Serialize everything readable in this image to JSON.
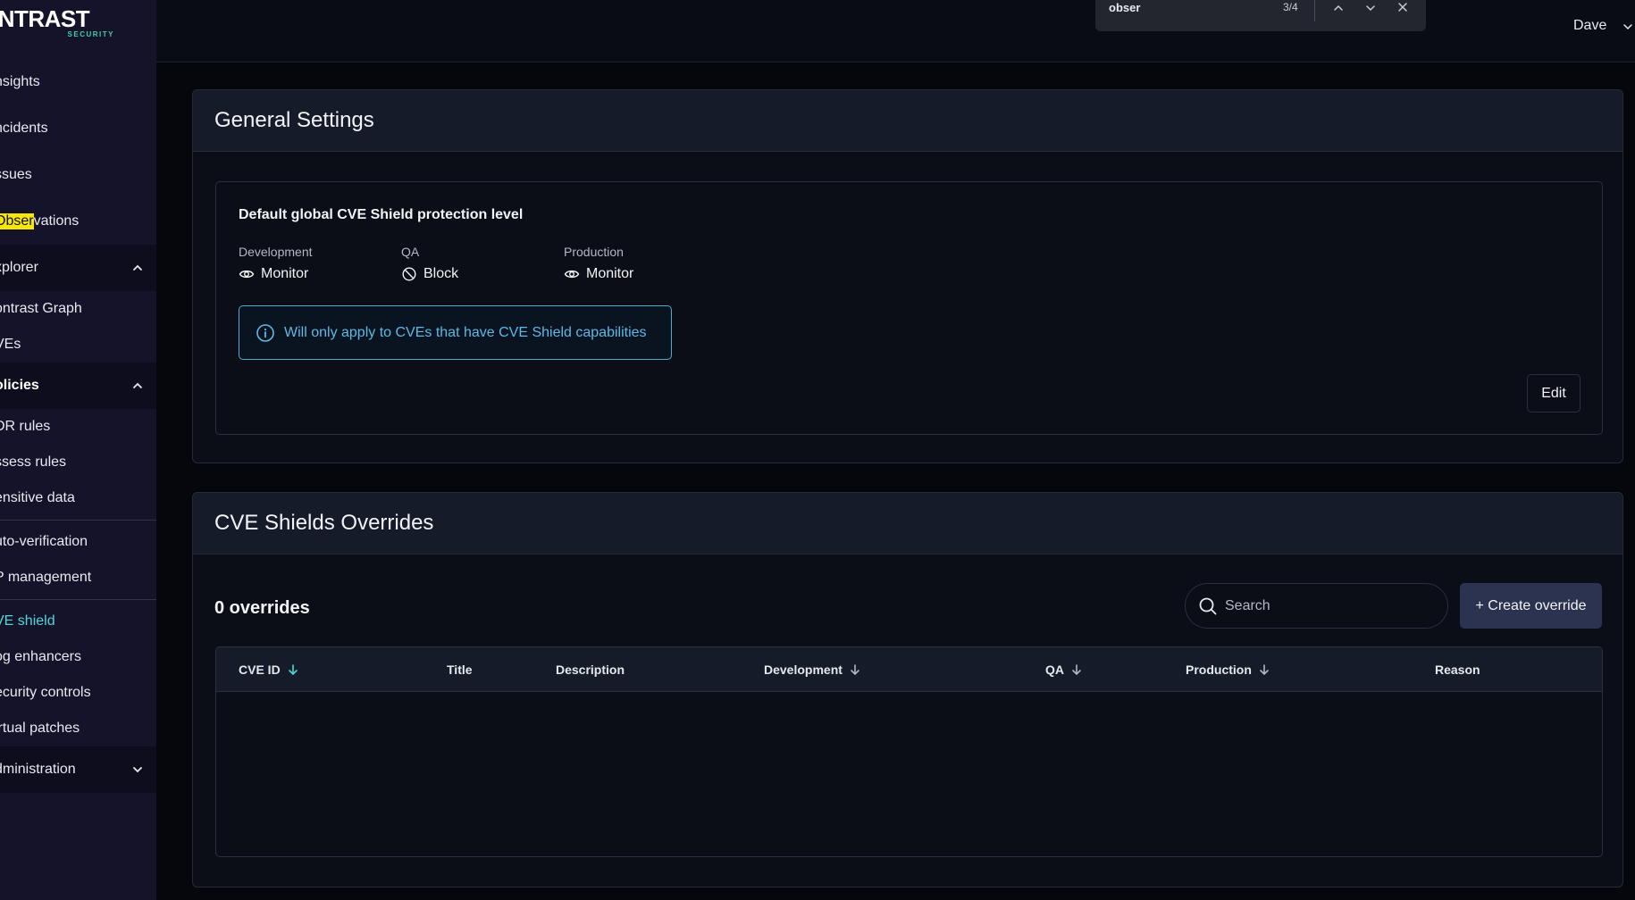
{
  "logo": {
    "main": "ONTRAST",
    "sub": "SECURITY"
  },
  "sidebar": {
    "items": [
      {
        "label": "nsights"
      },
      {
        "label": "ncidents"
      },
      {
        "label": "ssues"
      },
      {
        "label_highlight": "Obser",
        "label_rest": "vations"
      }
    ],
    "explorer": {
      "label": "xplorer",
      "items": [
        {
          "label": "ontrast Graph"
        },
        {
          "label": "VEs"
        }
      ]
    },
    "policies": {
      "label": "olicies",
      "items": [
        {
          "label": "DR rules"
        },
        {
          "label": "ssess rules"
        },
        {
          "label": "ensitive data"
        }
      ]
    },
    "group2": [
      {
        "label": "uto-verification"
      },
      {
        "label": "P management"
      }
    ],
    "group3": [
      {
        "label": "VE shield"
      },
      {
        "label": "og enhancers"
      },
      {
        "label": "ecurity controls"
      },
      {
        "label": "irtual patches"
      }
    ],
    "administration": {
      "label": "dministration"
    }
  },
  "findbar": {
    "query": "obser",
    "count": "3/4"
  },
  "user": {
    "name": "Dave"
  },
  "general_settings": {
    "title": "General Settings",
    "box_title": "Default global CVE Shield protection level",
    "envs": [
      {
        "label": "Development",
        "value": "Monitor",
        "icon": "eye-icon"
      },
      {
        "label": "QA",
        "value": "Block",
        "icon": "block-icon"
      },
      {
        "label": "Production",
        "value": "Monitor",
        "icon": "eye-icon"
      }
    ],
    "info": "Will only apply to CVEs that have CVE Shield capabilities",
    "edit_label": "Edit"
  },
  "overrides": {
    "title": "CVE Shields Overrides",
    "count_label": "0 overrides",
    "search_placeholder": "Search",
    "create_label": "+ Create override",
    "columns": [
      "CVE ID",
      "Title",
      "Description",
      "Development",
      "QA",
      "Production",
      "Reason"
    ]
  },
  "colors": {
    "accent": "#4fd6d8",
    "info": "#5fb8e6",
    "highlight": "#f5e60c",
    "button": "#2c3350"
  }
}
